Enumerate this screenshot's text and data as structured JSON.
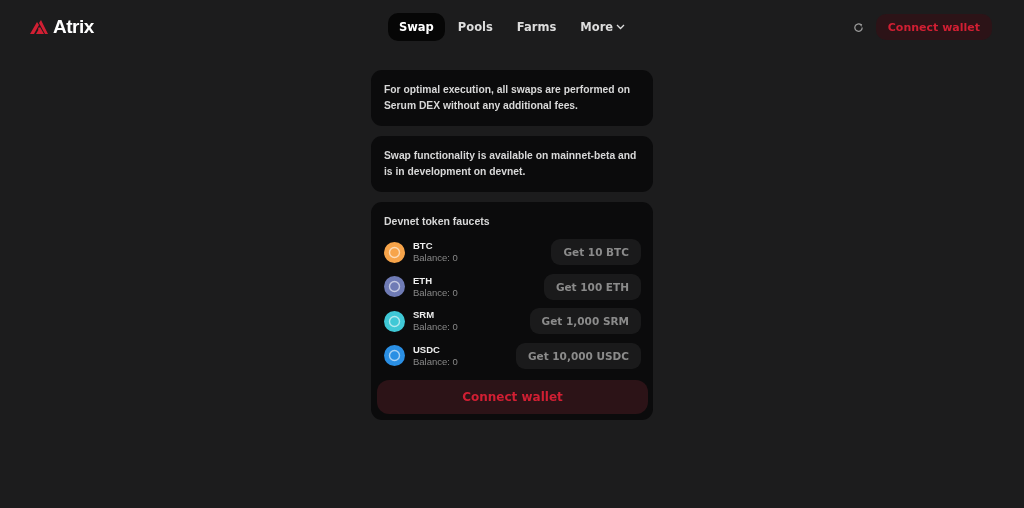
{
  "logo": {
    "text": "Atrix"
  },
  "nav": [
    {
      "label": "Swap",
      "selected": true,
      "dropdown": false
    },
    {
      "label": "Pools",
      "selected": false,
      "dropdown": false
    },
    {
      "label": "Farms",
      "selected": false,
      "dropdown": false
    },
    {
      "label": "More",
      "selected": false,
      "dropdown": true
    }
  ],
  "header_button": "Connect wallet",
  "notices": [
    "For optimal execution, all swaps are performed on Serum DEX without any additional fees.",
    "Swap functionality is available on mainnet-beta and is in development on devnet."
  ],
  "faucets": {
    "title": "Devnet token faucets",
    "tokens": [
      {
        "symbol": "BTC",
        "balance": "Balance: 0",
        "button": "Get 10 BTC",
        "color": "#f7a44a"
      },
      {
        "symbol": "ETH",
        "balance": "Balance: 0",
        "button": "Get 100 ETH",
        "color": "#6f7bb5"
      },
      {
        "symbol": "SRM",
        "balance": "Balance: 0",
        "button": "Get 1,000 SRM",
        "color": "#3fc8d6"
      },
      {
        "symbol": "USDC",
        "balance": "Balance: 0",
        "button": "Get 10,000 USDC",
        "color": "#2a8fe4"
      }
    ],
    "connect_button": "Connect wallet"
  }
}
